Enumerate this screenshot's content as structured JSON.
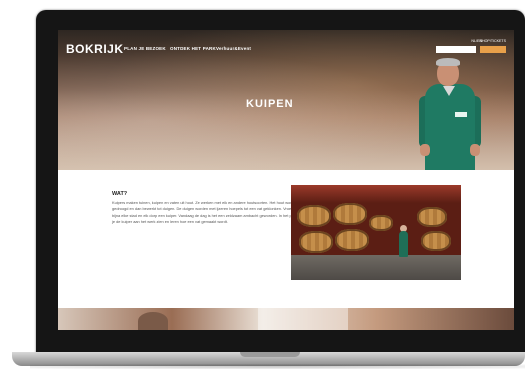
{
  "nav": {
    "logo": "BOKRIJK",
    "links": [
      "PLAN JE BEZOEK",
      "ONTDEK HET PARK",
      "Verhuur&Event"
    ],
    "top_links": [
      "NL/EN",
      "SHOP/TICKETS"
    ],
    "search_placeholder": ""
  },
  "hero": {
    "title": "KUIPEN"
  },
  "content": {
    "section_title": "WAT?",
    "paragraph": "Kuipers maken tuinen, kuipen en vaten uit hout. Ze werken met eik en andere houtsoorten. Het hout wordt eerst gedroogd en dan bewerkt tot duigen. De duigen worden met ijzeren hoepels tot een vat geklonken. Vroeger had bijna elke stad en elk dorp een kuiper. Vandaag de dag is het een zeldzaam ambacht geworden. In het park kan je de kuiper aan het werk zien en leren hoe een vat gemaakt wordt."
  },
  "colors": {
    "accent": "#e8a04a",
    "uniform": "#1f7a63"
  }
}
